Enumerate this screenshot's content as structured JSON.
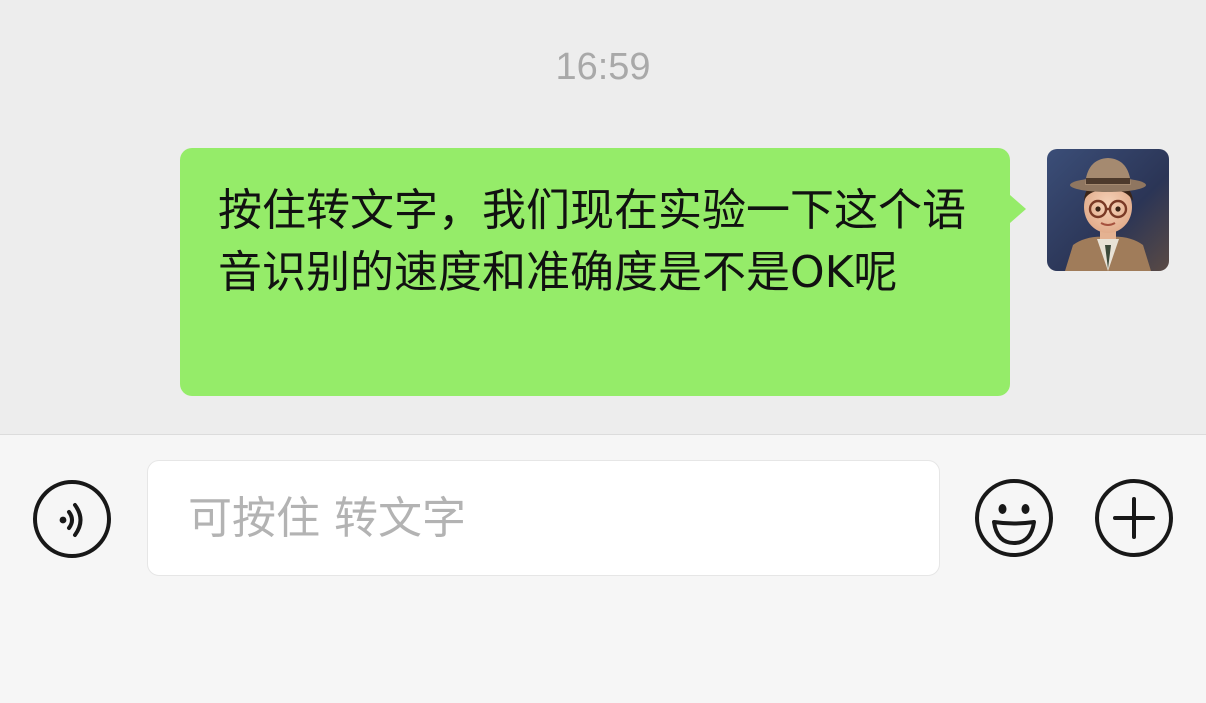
{
  "chat": {
    "timestamp": "16:59",
    "messages": [
      {
        "sender": "me",
        "text": "按住转文字，我们现在实验一下这个语音识别的速度和准确度是不是OK呢",
        "avatar_icon": "user-avatar-cartoon-man-hat-glasses"
      }
    ]
  },
  "input_bar": {
    "voice_icon": "voice-toggle-icon",
    "placeholder": "可按住 转文字",
    "value": "",
    "emoji_icon": "emoji-smile-icon",
    "more_icon": "plus-circle-icon"
  },
  "colors": {
    "bubble_me": "#95ec69",
    "chat_background": "#ededed",
    "input_bar_background": "#f6f6f6"
  }
}
